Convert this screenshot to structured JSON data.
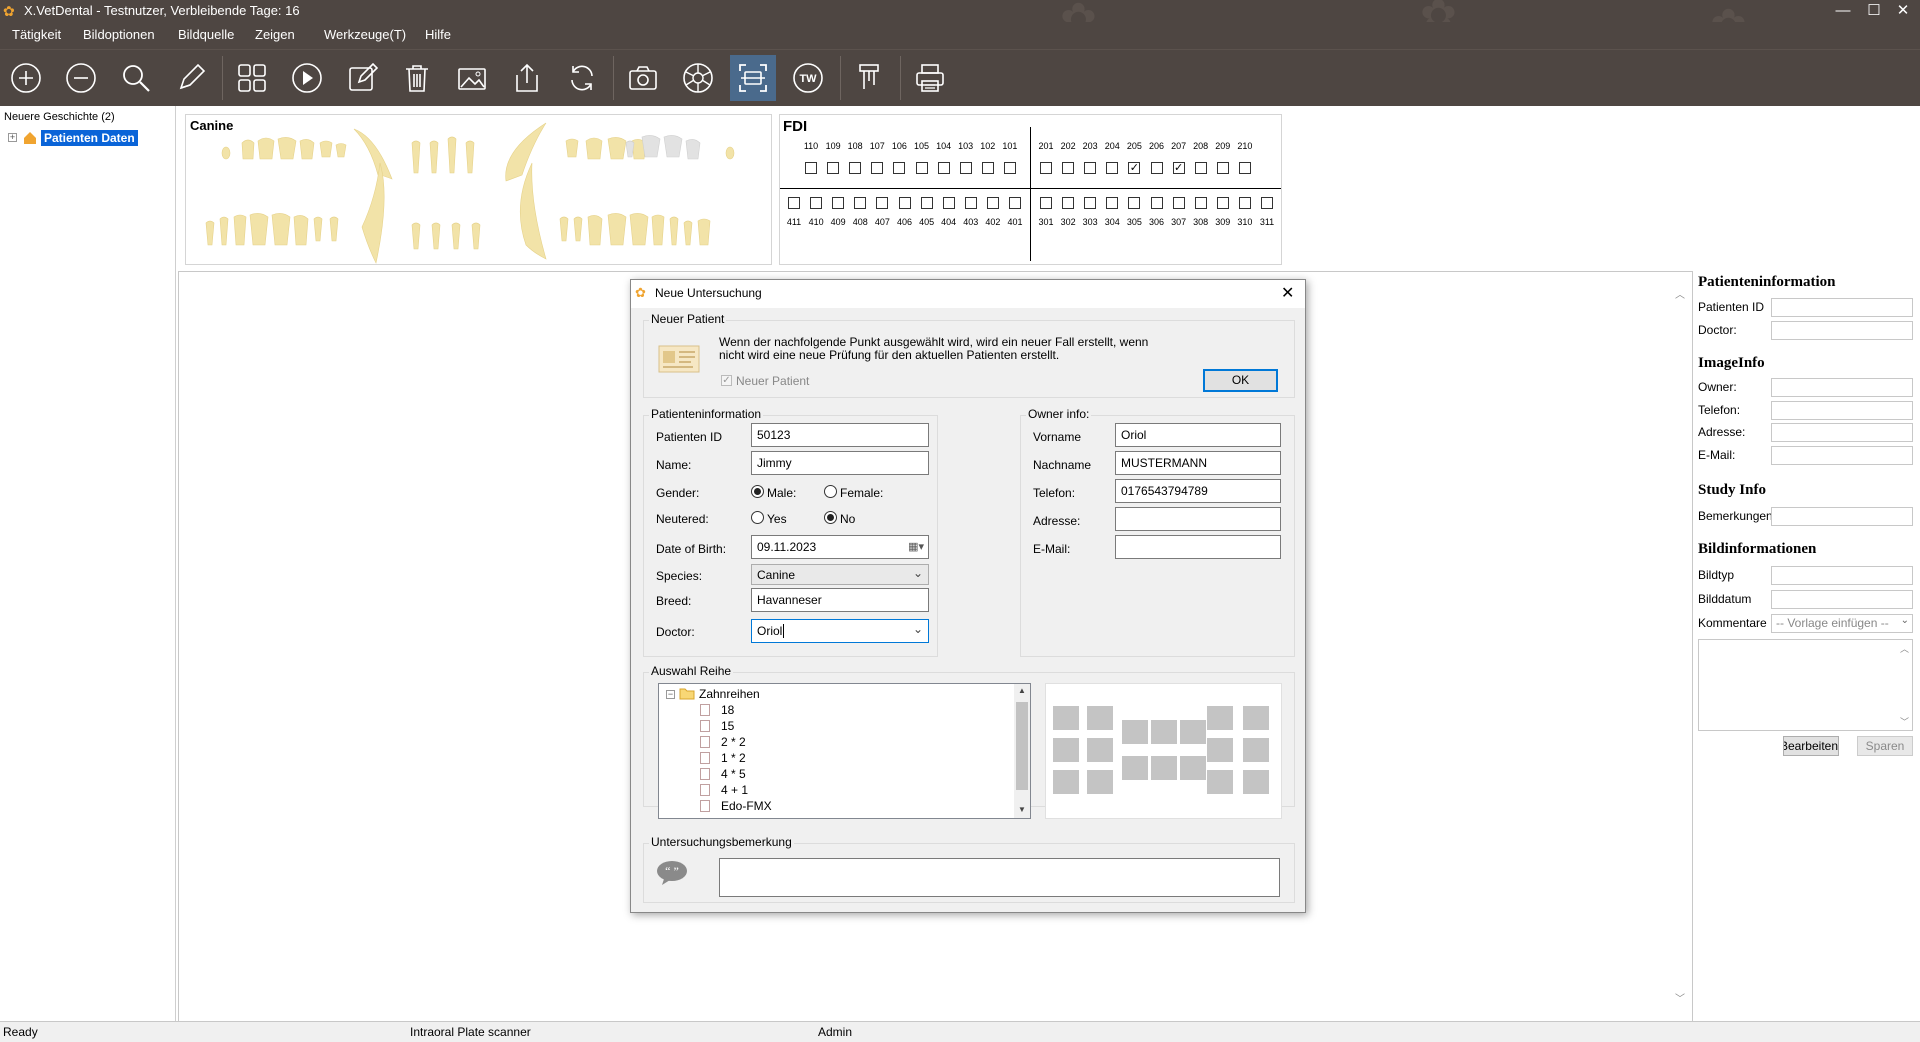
{
  "window": {
    "title": "X.VetDental - Testnutzer, Verbleibende Tage: 16",
    "logo_icon": "paw-icon",
    "controls": [
      "—",
      "☐",
      "✕"
    ]
  },
  "menu": [
    "Tätigkeit",
    "Bildoptionen",
    "Bildquelle",
    "Zeigen",
    "Werkzeuge(T)",
    "Hilfe"
  ],
  "toolbar": {
    "buttons": [
      "zoom-in",
      "zoom-out",
      "magnifier",
      "pencil",
      "grid-layout",
      "play",
      "edit",
      "delete",
      "image",
      "export",
      "refresh",
      "camera",
      "aperture",
      "scan-frame",
      "tw",
      "sensor",
      "print"
    ],
    "tw_label": "TW",
    "active": "scan-frame",
    "accent": "#4a6a8c",
    "background": "#4e4642"
  },
  "left_panel": {
    "header": "Neuere Geschichte (2)",
    "tree_item": "Patienten Daten",
    "expander": "+"
  },
  "tooth_chart": {
    "title": "Canine"
  },
  "fdi": {
    "title": "FDI",
    "upper_left": [
      "110",
      "109",
      "108",
      "107",
      "106",
      "105",
      "104",
      "103",
      "102",
      "101"
    ],
    "upper_right": [
      "201",
      "202",
      "203",
      "204",
      "205",
      "206",
      "207",
      "208",
      "209",
      "210"
    ],
    "lower_left": [
      "411",
      "410",
      "409",
      "408",
      "407",
      "406",
      "405",
      "404",
      "403",
      "402",
      "401"
    ],
    "lower_right": [
      "301",
      "302",
      "303",
      "304",
      "305",
      "306",
      "307",
      "308",
      "309",
      "310",
      "311"
    ],
    "upper_right_checked": [
      false,
      false,
      false,
      false,
      true,
      false,
      true,
      false,
      false,
      false
    ]
  },
  "right_panel": {
    "patient_header": "Patienteninformation",
    "patient_id_label": "Patienten ID",
    "doctor_label": "Doctor:",
    "image_header": "ImageInfo",
    "owner_label": "Owner:",
    "phone_label": "Telefon:",
    "address_label": "Adresse:",
    "email_label": "E-Mail:",
    "study_header": "Study Info",
    "remarks_label": "Bemerkungen",
    "bild_header": "Bildinformationen",
    "bildtyp_label": "Bildtyp",
    "bilddatum_label": "Bilddatum",
    "kommentare_label": "Kommentare",
    "template_placeholder": "-- Vorlage einfügen --",
    "edit_button": "Bearbeiten",
    "save_button": "Sparen"
  },
  "statusbar": {
    "status": "Ready",
    "device": "Intraoral Plate scanner",
    "user": "Admin"
  },
  "dialog": {
    "title": "Neue Untersuchung",
    "new_patient_group": "Neuer Patient",
    "info_text_1": "Wenn der nachfolgende Punkt ausgewählt wird, wird ein neuer Fall erstellt, wenn",
    "info_text_2": "nicht wird eine neue Prüfung für den aktuellen Patienten erstellt.",
    "new_patient_checkbox": "Neuer Patient",
    "ok_button": "OK",
    "patient_group": "Patienteninformation",
    "patient_id_label": "Patienten ID",
    "patient_id": "50123",
    "name_label": "Name:",
    "name": "Jimmy",
    "gender_label": "Gender:",
    "male": "Male:",
    "female": "Female:",
    "neutered_label": "Neutered:",
    "yes": "Yes",
    "no": "No",
    "dob_label": "Date of Birth:",
    "dob": "09.11.2023",
    "species_label": "Species:",
    "species": "Canine",
    "breed_label": "Breed:",
    "breed": "Havanneser",
    "doctor_label": "Doctor:",
    "doctor": "Oriol",
    "owner_group": "Owner info:",
    "vorname_label": "Vorname",
    "vorname": "Oriol",
    "nachname_label": "Nachname",
    "nachname": "MUSTERMANN",
    "telefon_label": "Telefon:",
    "telefon": "0176543794789",
    "adresse_label": "Adresse:",
    "adresse": "",
    "email_label": "E-Mail:",
    "email": "",
    "series_group": "Auswahl Reihe",
    "tree_root": "Zahnreihen",
    "tree_items": [
      "18",
      "15",
      "2 * 2",
      "1 * 2",
      "4 * 5",
      "4 + 1",
      "Edo-FMX"
    ],
    "remark_group": "Untersuchungsbemerkung",
    "remark": ""
  }
}
